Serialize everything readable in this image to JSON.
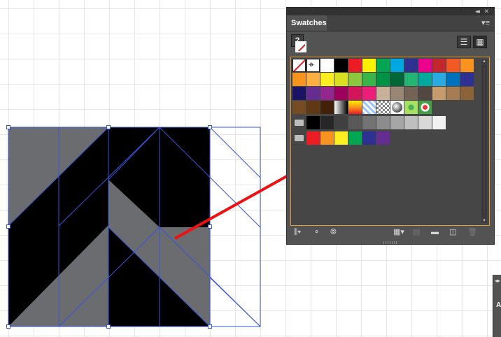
{
  "panel": {
    "title": "Swatches",
    "collapse_glyph": "◂◂",
    "close_glyph": "✕",
    "menu_glyph": "▾≡",
    "unknown_fill_glyph": "?",
    "list_view_glyph": "☰",
    "grid_view_glyph": "▦"
  },
  "side_stub_label": "A",
  "colors": {
    "artwork_gray": "#6b6c70",
    "artwork_black": "#000000",
    "selection_blue": "#3556d8",
    "annotation_red": "#ee1111",
    "panel_bg": "#535353",
    "active_border": "#e2a13a"
  },
  "bottom_icons": [
    {
      "name": "swatch-libraries-menu-icon",
      "glyph": "⫼▾",
      "enabled": true
    },
    {
      "name": "place-swatches-icon",
      "glyph": "⚬",
      "enabled": true
    },
    {
      "name": "swatch-options-cc-icon",
      "glyph": "⦾",
      "enabled": true
    },
    {
      "name": "show-swatch-kinds-icon",
      "glyph": "▦▾",
      "enabled": true
    },
    {
      "name": "swatch-options-icon",
      "glyph": "▤",
      "enabled": false
    },
    {
      "name": "new-color-group-icon",
      "glyph": "▬",
      "enabled": true
    },
    {
      "name": "new-swatch-icon",
      "glyph": "◫",
      "enabled": true
    },
    {
      "name": "delete-swatch-icon",
      "glyph": "🗑",
      "enabled": false
    }
  ],
  "swatch_rows": [
    [
      "none",
      "registration",
      "#ffffff",
      "#000000",
      "#ec1c24",
      "#fff200",
      "#00a651",
      "#00a8e1",
      "#2e3192",
      "#ec008c",
      "#c1272d",
      "#f15a24",
      "#f7931e"
    ],
    [
      "#f7941d",
      "#fbb040",
      "#fcee21",
      "#d9e021",
      "#8cc63f",
      "#39b54a",
      "#009245",
      "#006837",
      "#22b573",
      "#00a99d",
      "#29abe2",
      "#0071bc",
      "#2e3192"
    ],
    [
      "#1b1464",
      "#662d91",
      "#93278f",
      "#9e005d",
      "#d4145a",
      "#ed1e79",
      "#c7b299",
      "#998675",
      "#736357",
      "#534741",
      "#c69c6d",
      "#a67c52",
      "#8c6239"
    ],
    [
      "#754c24",
      "#603813",
      "#42210b",
      "gradient-bw",
      "gradient-orange",
      "pattern-blue",
      "pattern-check",
      "pattern-sphere",
      "pattern-leaf",
      "pattern-floral"
    ],
    [
      "folder",
      "#000000",
      "#262626",
      "#404040",
      "#595959",
      "#737373",
      "#8c8c8c",
      "#a6a6a6",
      "#bfbfbf",
      "#d9d9d9",
      "#f2f2f2"
    ],
    [
      "folder",
      "#ec1c24",
      "#f7931e",
      "#fcee21",
      "#00a651",
      "#2e3192",
      "#662d91"
    ]
  ]
}
